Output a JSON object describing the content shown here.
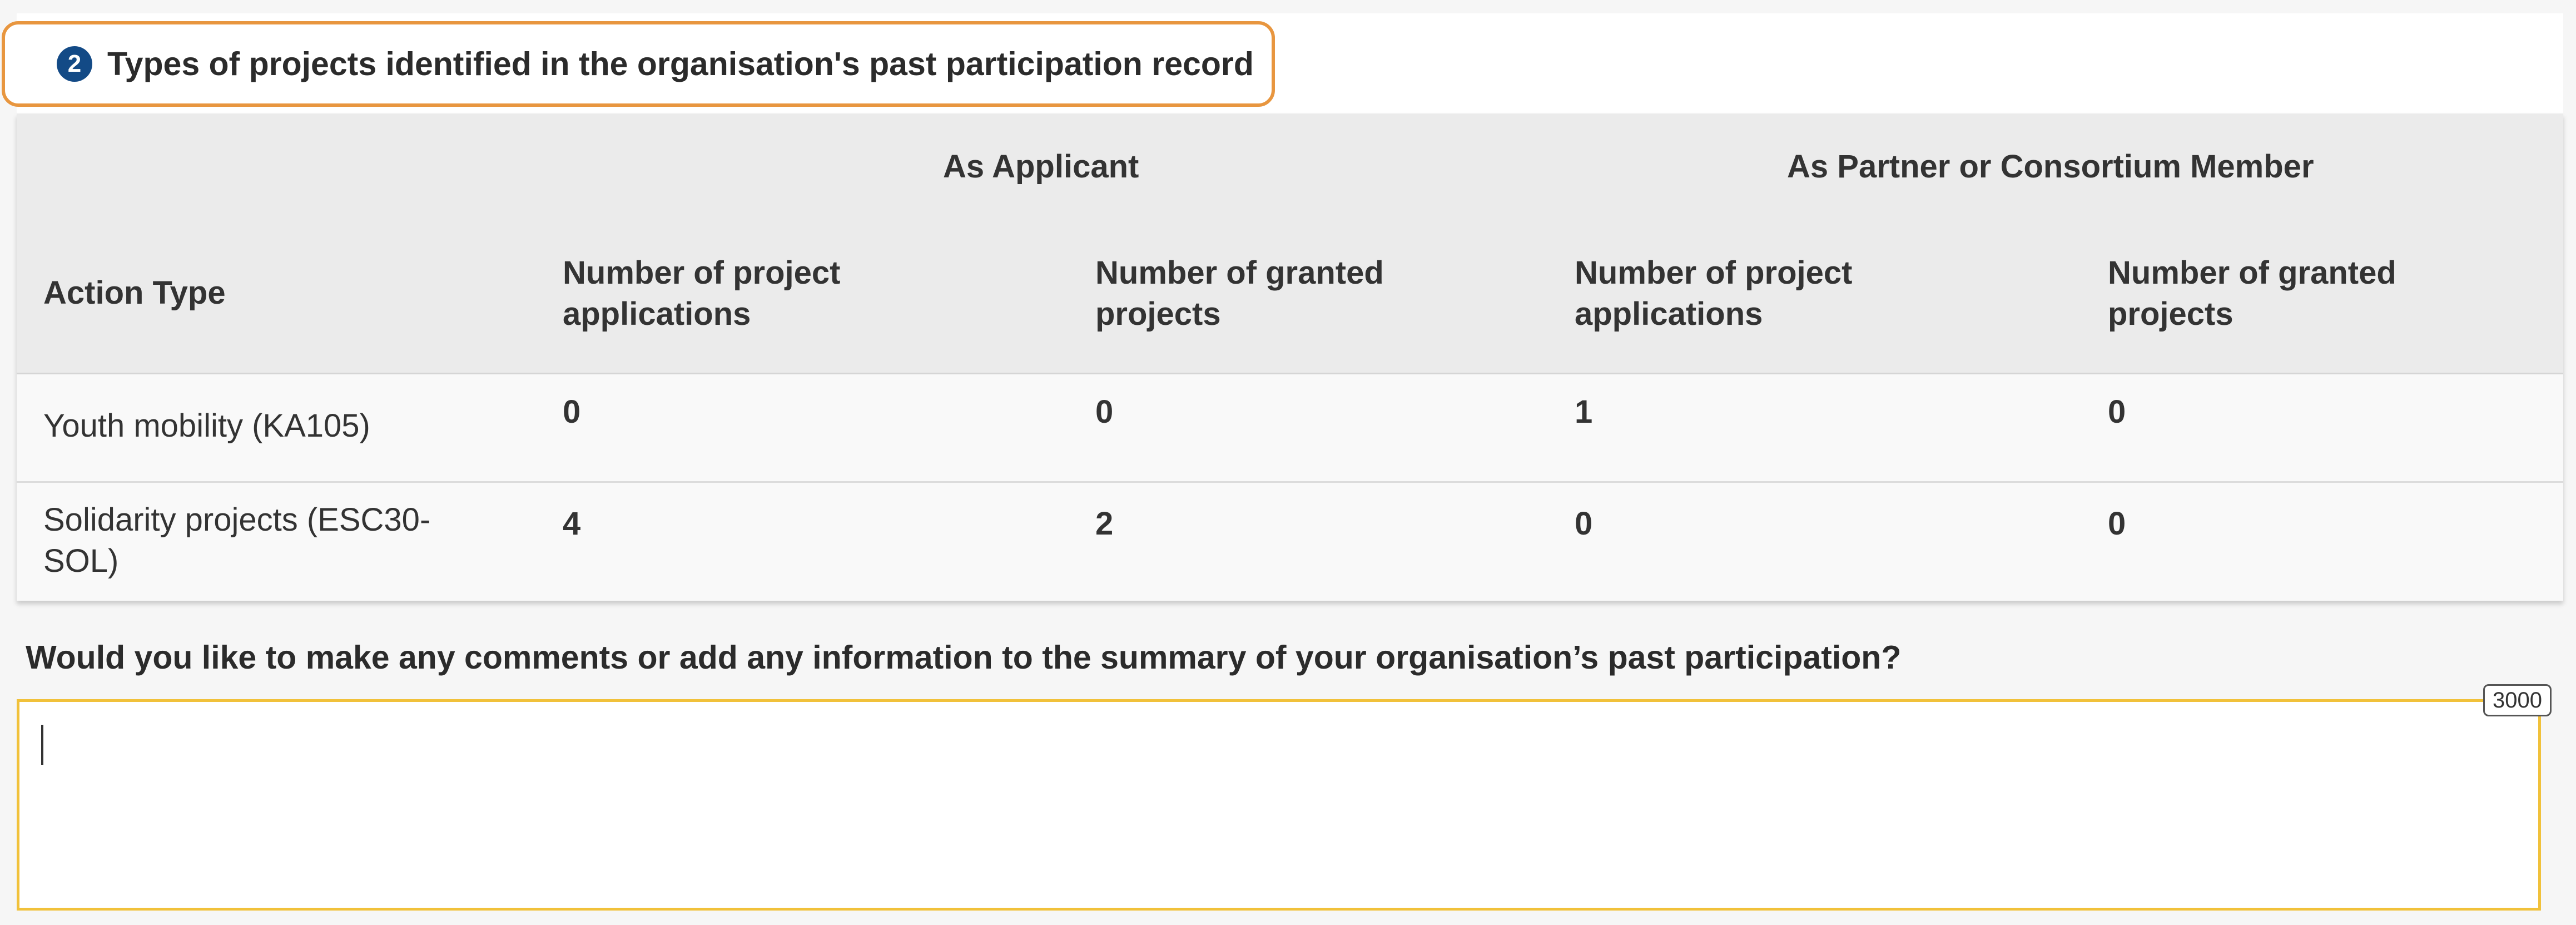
{
  "section": {
    "step_number": "2",
    "title": "Types of projects identified in the organisation's past participation record"
  },
  "table": {
    "group_headers": {
      "applicant": "As Applicant",
      "partner": "As Partner or Consortium Member"
    },
    "column_headers": {
      "action_type": "Action Type",
      "applicant_applications": "Number of project applications",
      "applicant_granted": "Number of granted projects",
      "partner_applications": "Number of project applications",
      "partner_granted": "Number of granted projects"
    },
    "rows": [
      {
        "action_type": "Youth mobility (KA105)",
        "applicant_applications": "0",
        "applicant_granted": "0",
        "partner_applications": "1",
        "partner_granted": "0"
      },
      {
        "action_type": "Solidarity projects (ESC30-SOL)",
        "applicant_applications": "4",
        "applicant_granted": "2",
        "partner_applications": "0",
        "partner_granted": "0"
      }
    ]
  },
  "comments": {
    "question": "Would you like to make any comments or add any information to the summary of your organisation’s past participation?",
    "value": "",
    "max_characters": "3000"
  },
  "colors": {
    "title_border": "#e8963f",
    "step_badge": "#134a86",
    "textarea_border": "#f1c13a",
    "header_background": "#ebebeb"
  }
}
